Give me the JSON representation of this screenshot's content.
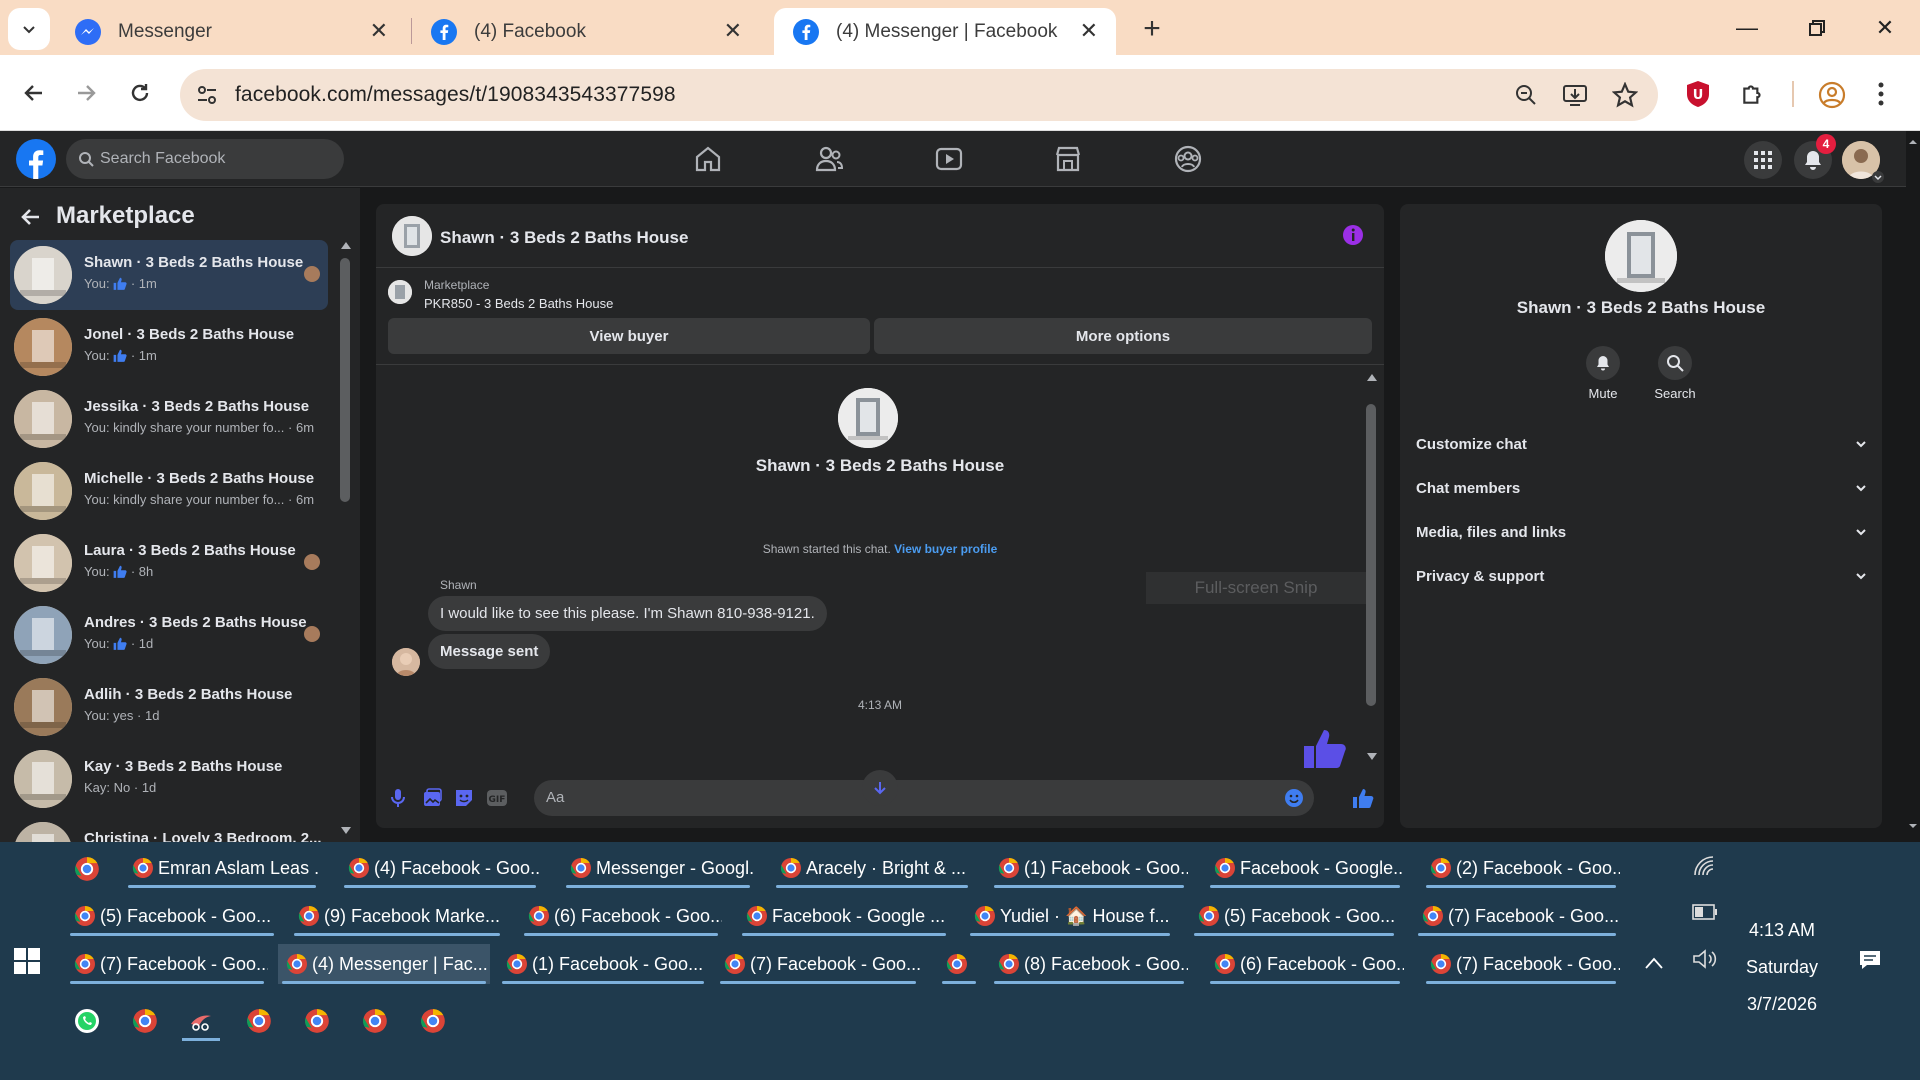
{
  "browser": {
    "tabs": [
      {
        "title": "Messenger",
        "icon": "messenger-icon",
        "active": false
      },
      {
        "title": "(4) Facebook",
        "icon": "facebook-icon",
        "active": false
      },
      {
        "title": "(4) Messenger | Facebook",
        "icon": "facebook-icon",
        "active": true
      }
    ],
    "url": "facebook.com/messages/t/1908343543377598"
  },
  "facebook": {
    "search_placeholder": "Search Facebook",
    "notification_count": "4",
    "brand_color": "#1877f2"
  },
  "sidebar": {
    "title": "Marketplace",
    "conversations": [
      {
        "name": "Shawn · 3 Beds 2 Baths House",
        "preview": "You:",
        "time": "· 1m",
        "like": true,
        "selected": true
      },
      {
        "name": "Jonel · 3 Beds 2 Baths House",
        "preview": "You:",
        "time": "· 1m",
        "like": true
      },
      {
        "name": "Jessika · 3 Beds 2 Baths House",
        "preview": "You: kindly share your number fo...",
        "time": "· 6m",
        "like": false
      },
      {
        "name": "Michelle · 3 Beds 2 Baths House",
        "preview": "You: kindly share your number fo...",
        "time": "· 6m",
        "like": false
      },
      {
        "name": "Laura · 3 Beds 2 Baths House",
        "preview": "You:",
        "time": "· 8h",
        "like": true
      },
      {
        "name": "Andres · 3 Beds 2 Baths House",
        "preview": "You:",
        "time": "· 1d",
        "like": true
      },
      {
        "name": "Adlih · 3 Beds 2 Baths House",
        "preview": "You: yes",
        "time": "· 1d",
        "like": false
      },
      {
        "name": "Kay · 3 Beds 2 Baths House",
        "preview": "Kay: No",
        "time": "· 1d",
        "like": false
      },
      {
        "name": "Christina · Lovely 3 Bedroom, 2...",
        "preview": "",
        "time": "",
        "like": false
      }
    ]
  },
  "chat": {
    "title": "Shawn · 3 Beds 2 Baths House",
    "marketplace_label": "Marketplace",
    "listing": "PKR850 - 3 Beds 2 Baths House",
    "view_buyer": "View buyer",
    "more_options": "More options",
    "started_text": "Shawn started this chat.",
    "view_buyer_profile": "View buyer profile",
    "sender": "Shawn",
    "messages": [
      "I would like to see this please. I'm Shawn 810-938-9121.",
      "Message sent"
    ],
    "timestamp": "4:13 AM",
    "snip_overlay": "Full-screen Snip",
    "composer_placeholder": "Aa"
  },
  "details": {
    "name": "Shawn · 3 Beds 2 Baths House",
    "mute": "Mute",
    "search": "Search",
    "sections": [
      "Customize chat",
      "Chat members",
      "Media, files and links",
      "Privacy & support"
    ]
  },
  "taskbar": {
    "row1": [
      "Emran Aslam Leas ...",
      "(4) Facebook - Goo...",
      "Messenger - Googl...",
      "Aracely · Bright & ...",
      "(1) Facebook - Goo...",
      "Facebook - Google...",
      "(2) Facebook - Goo..."
    ],
    "row2": [
      "(5) Facebook - Goo...",
      "(9) Facebook Marke...",
      "(6) Facebook - Goo...",
      "Facebook - Google ...",
      "Yudiel · 🏠 House f...",
      "(5) Facebook - Goo...",
      "(7) Facebook - Goo..."
    ],
    "row3": [
      "(7) Facebook - Goo...",
      "(4) Messenger | Fac...",
      "(1) Facebook - Goo...",
      "(7) Facebook - Goo...",
      "",
      "(8) Facebook - Goo...",
      "(6) Facebook - Goo...",
      "(7) Facebook - Goo..."
    ],
    "clock_time": "4:13 AM",
    "clock_day": "Saturday",
    "clock_date": "3/7/2026"
  }
}
